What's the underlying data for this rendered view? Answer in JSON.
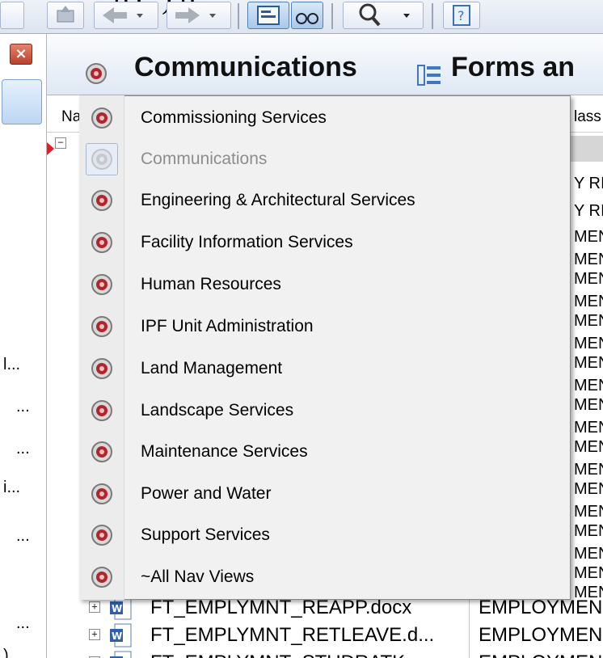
{
  "toolbar": {
    "clipped_text": "p (, ) p "
  },
  "left_panel": {
    "close_glyph": "×",
    "truncated_items": [
      "l...",
      "...",
      "...",
      "i...",
      "...",
      "...",
      ")"
    ]
  },
  "header": {
    "title": "Communications",
    "next_tab": "Forms an"
  },
  "columns": {
    "name": "Na",
    "class": "lass"
  },
  "background_right_cells": [
    "Y RI",
    "Y RI",
    "MEN",
    "MEN",
    "MEN",
    "MEN",
    "MEN",
    "MEN",
    "MEN",
    "MEN",
    "MEN",
    "MEN",
    "MEN",
    "MEN",
    "MEN",
    "MEN",
    "MEN",
    "MEN",
    "MEN",
    "MEN"
  ],
  "menu": {
    "items": [
      {
        "label": "Commissioning Services",
        "state": "normal",
        "icon": "nav-view-icon"
      },
      {
        "label": "Communications",
        "state": "disabled",
        "icon": "nav-view-icon"
      },
      {
        "label": "Engineering & Architectural Services",
        "state": "normal",
        "icon": "nav-view-icon"
      },
      {
        "label": "Facility Information Services",
        "state": "normal",
        "icon": "nav-view-icon"
      },
      {
        "label": "Human Resources",
        "state": "normal",
        "icon": "nav-view-icon"
      },
      {
        "label": "IPF Unit Administration",
        "state": "normal",
        "icon": "nav-view-icon"
      },
      {
        "label": "Land Management",
        "state": "normal",
        "icon": "nav-view-icon"
      },
      {
        "label": "Landscape Services",
        "state": "normal",
        "icon": "nav-view-icon"
      },
      {
        "label": "Maintenance Services",
        "state": "normal",
        "icon": "nav-view-icon"
      },
      {
        "label": "Power and Water",
        "state": "normal",
        "icon": "nav-view-icon"
      },
      {
        "label": "Support Services",
        "state": "normal",
        "icon": "nav-view-icon"
      },
      {
        "label": "~All Nav Views",
        "state": "normal",
        "icon": "nav-view-icon"
      }
    ]
  },
  "files": [
    {
      "name": "FT_EMPLYMNT_REAPP.docx",
      "class": "EMPLOYMEN"
    },
    {
      "name": "FT_EMPLYMNT_RETLEAVE.d...",
      "class": "EMPLOYMEN"
    },
    {
      "name": "FT_EMPLYMNT_STUDRATK",
      "class": "EMPLOYMEN"
    }
  ],
  "colors": {
    "icon_red": "#b0262c",
    "icon_gray": "#8a8a8a",
    "menu_bg": "#f1f1f1",
    "accent_blue": "#7fa4cf"
  }
}
